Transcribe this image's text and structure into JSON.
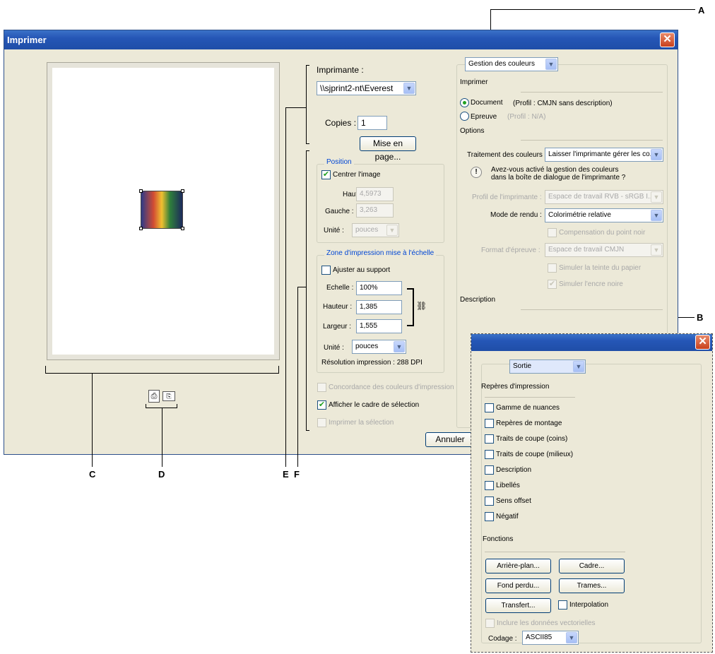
{
  "callouts": {
    "a": "A",
    "b": "B",
    "c": "C",
    "d": "D",
    "e": "E",
    "f": "F"
  },
  "window": {
    "title": "Imprimer",
    "close": "✕"
  },
  "printer": {
    "label": "Imprimante :",
    "value": "\\\\sjprint2-nt\\Everest",
    "copies_label": "Copies :",
    "copies_value": "1",
    "page_setup": "Mise en page..."
  },
  "position": {
    "legend": "Position",
    "center_label": "Centrer l'image",
    "center_checked": true,
    "top_label": "Haut :",
    "top_value": "4,5973",
    "left_label": "Gauche :",
    "left_value": "3,263",
    "unit_label": "Unité :",
    "unit_value": "pouces"
  },
  "scale": {
    "legend": "Zone d'impression mise à l'échelle",
    "fit_label": "Ajuster au support",
    "scale_label": "Echelle :",
    "scale_value": "100%",
    "height_label": "Hauteur :",
    "height_value": "1,385",
    "width_label": "Largeur :",
    "width_value": "1,555",
    "unit_label": "Unité :",
    "unit_value": "pouces",
    "resolution": "Résolution impression : 288 DPI"
  },
  "options": {
    "match_colors": "Concordance des couleurs d'impression",
    "show_bbox": "Afficher le cadre de sélection",
    "print_selection": "Imprimer la sélection"
  },
  "buttons": {
    "cancel": "Annuler"
  },
  "color_panel": {
    "mode": "Gestion des couleurs",
    "print_heading": "Imprimer",
    "document_label": "Document",
    "document_profile": "(Profil : CMJN sans description)",
    "proof_label": "Epreuve",
    "proof_profile": "(Profil : N/A)",
    "options_heading": "Options",
    "handling_label": "Traitement des couleurs :",
    "handling_value": "Laisser l'imprimante gérer les co...",
    "notice_line1": "Avez-vous activé la gestion des couleurs",
    "notice_line2": "dans la boîte de dialogue de l'imprimante ?",
    "printer_profile_label": "Profil de l'imprimante :",
    "printer_profile_value": "Espace de travail RVB - sRGB I...",
    "intent_label": "Mode de rendu :",
    "intent_value": "Colorimétrie relative",
    "bpc_label": "Compensation du point noir",
    "proof_setup_label": "Format d'épreuve :",
    "proof_setup_value": "Espace de travail CMJN",
    "paper_label": "Simuler la teinte du papier",
    "ink_label": "Simuler l'encre noire",
    "description_heading": "Description"
  },
  "output_panel": {
    "mode": "Sortie",
    "marks_heading": "Repères d'impression",
    "marks": [
      "Gamme de nuances",
      "Repères de montage",
      "Traits de coupe (coins)",
      "Traits de coupe (milieux)",
      "Description",
      "Libellés",
      "Sens offset",
      "Négatif"
    ],
    "functions_heading": "Fonctions",
    "background_btn": "Arrière-plan...",
    "border_btn": "Cadre...",
    "bleed_btn": "Fond perdu...",
    "screen_btn": "Trames...",
    "transfer_btn": "Transfert...",
    "interpolation_label": "Interpolation",
    "vector_label": "Inclure les données vectorielles",
    "encoding_label": "Codage :",
    "encoding_value": "ASCII85"
  },
  "colors": {
    "title_bar": "#2556b6",
    "dialog_bg": "#ece9d8",
    "check_green": "#21a121",
    "legend_blue": "#0046d5"
  }
}
